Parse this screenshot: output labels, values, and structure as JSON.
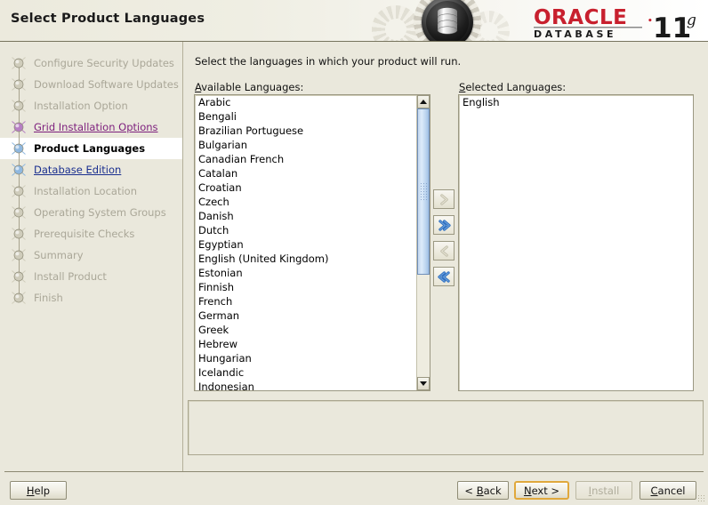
{
  "window": {
    "title": "Select Product Languages",
    "product_brand": "ORACLE",
    "product_line": "DATABASE",
    "product_version": "11",
    "product_version_suffix": "g",
    "brand_color": "#c8202e"
  },
  "sidebar": {
    "items": [
      {
        "label": "Configure Security Updates",
        "state": "pending",
        "icon": "node-icon"
      },
      {
        "label": "Download Software Updates",
        "state": "pending",
        "icon": "node-icon"
      },
      {
        "label": "Installation Option",
        "state": "pending",
        "icon": "node-icon"
      },
      {
        "label": "Grid Installation Options",
        "state": "done",
        "icon": "node-icon"
      },
      {
        "label": "Product Languages",
        "state": "current",
        "icon": "node-icon"
      },
      {
        "label": "Database Edition",
        "state": "link",
        "icon": "node-icon"
      },
      {
        "label": "Installation Location",
        "state": "pending",
        "icon": "node-icon"
      },
      {
        "label": "Operating System Groups",
        "state": "pending",
        "icon": "node-icon"
      },
      {
        "label": "Prerequisite Checks",
        "state": "pending",
        "icon": "node-icon"
      },
      {
        "label": "Summary",
        "state": "pending",
        "icon": "node-icon"
      },
      {
        "label": "Install Product",
        "state": "pending",
        "icon": "node-icon"
      },
      {
        "label": "Finish",
        "state": "pending",
        "icon": "node-icon"
      }
    ]
  },
  "main": {
    "instruction": "Select the languages in which your product will run.",
    "available": {
      "label_mnemonic": "A",
      "label_rest": "vailable Languages:",
      "items": [
        "Arabic",
        "Bengali",
        "Brazilian Portuguese",
        "Bulgarian",
        "Canadian French",
        "Catalan",
        "Croatian",
        "Czech",
        "Danish",
        "Dutch",
        "Egyptian",
        "English (United Kingdom)",
        "Estonian",
        "Finnish",
        "French",
        "German",
        "Greek",
        "Hebrew",
        "Hungarian",
        "Icelandic",
        "Indonesian"
      ]
    },
    "selected": {
      "label_mnemonic": "S",
      "label_rest": "elected Languages:",
      "items": [
        "English"
      ]
    },
    "transfer_buttons": [
      {
        "name": "move-right-button",
        "icon": "chevron-right-icon",
        "enabled": false
      },
      {
        "name": "move-all-right-button",
        "icon": "double-chevron-right-icon",
        "enabled": true
      },
      {
        "name": "move-left-button",
        "icon": "chevron-left-icon",
        "enabled": false
      },
      {
        "name": "move-all-left-button",
        "icon": "double-chevron-left-icon",
        "enabled": true
      }
    ],
    "message_panel": ""
  },
  "footer": {
    "help": {
      "mnemonic": "H",
      "before": "",
      "after": "elp"
    },
    "back": {
      "mnemonic": "B",
      "before": "< ",
      "after": "ack"
    },
    "next": {
      "mnemonic": "N",
      "before": "",
      "after": "ext >"
    },
    "install": {
      "mnemonic": "I",
      "before": "",
      "after": "nstall"
    },
    "cancel": {
      "mnemonic": "C",
      "before": "",
      "after": "ancel"
    }
  }
}
